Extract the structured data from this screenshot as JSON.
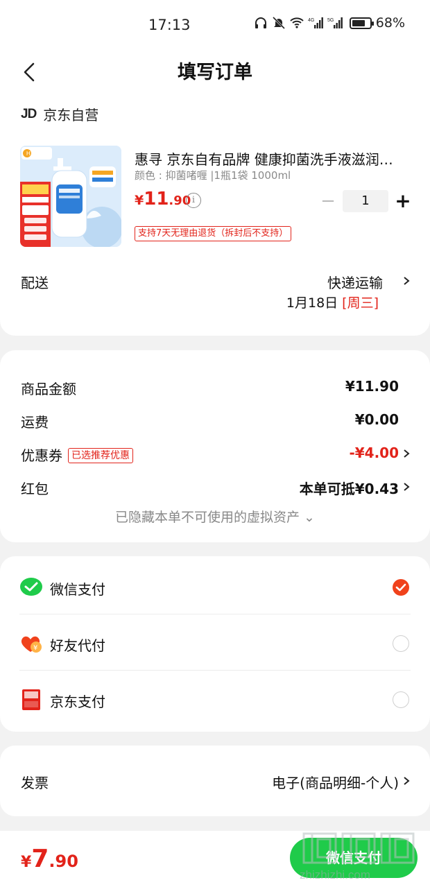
{
  "status_bar": {
    "time": "17:13",
    "battery": "68%"
  },
  "header": {
    "title": "填写订单"
  },
  "shop": {
    "logo": "JD",
    "name": "京东自营"
  },
  "product": {
    "title": "惠寻 京东自有品牌 健康抑菌洗手液滋润…",
    "spec": "颜色 : 抑菌啫喱 |1瓶1袋 1000ml",
    "price_currency": "¥",
    "price_int": "11",
    "price_dec": ".90",
    "quantity": "1",
    "return_tag": "支持7天无理由退货（拆封后不支持）"
  },
  "delivery": {
    "label": "配送",
    "method": "快递运输",
    "date": "1月18日",
    "weekday": "[周三]"
  },
  "summary": {
    "goods_amount_label": "商品金额",
    "goods_amount": "¥11.90",
    "shipping_label": "运费",
    "shipping": "¥0.00",
    "coupon_label": "优惠券",
    "coupon_tag": "已选推荐优惠",
    "coupon_value": "-¥4.00",
    "red_packet_label": "红包",
    "red_packet_value": "本单可抵¥0.43",
    "hidden_assets": "已隐藏本单不可使用的虚拟资产 ⌄"
  },
  "payment": {
    "options": [
      {
        "label": "微信支付",
        "selected": true
      },
      {
        "label": "好友代付",
        "selected": false
      },
      {
        "label": "京东支付",
        "selected": false
      }
    ]
  },
  "invoice": {
    "label": "发票",
    "value": "电子(商品明细-个人)"
  },
  "footer": {
    "total_currency": "¥",
    "total_int": "7",
    "total_dec": ".90",
    "pay_button": "微信支付",
    "watermark_site": "zhizhizhi.com"
  },
  "colors": {
    "accent_red": "#e2231a",
    "wechat_green": "#1fcb4a",
    "radio_on": "#f0421c"
  }
}
